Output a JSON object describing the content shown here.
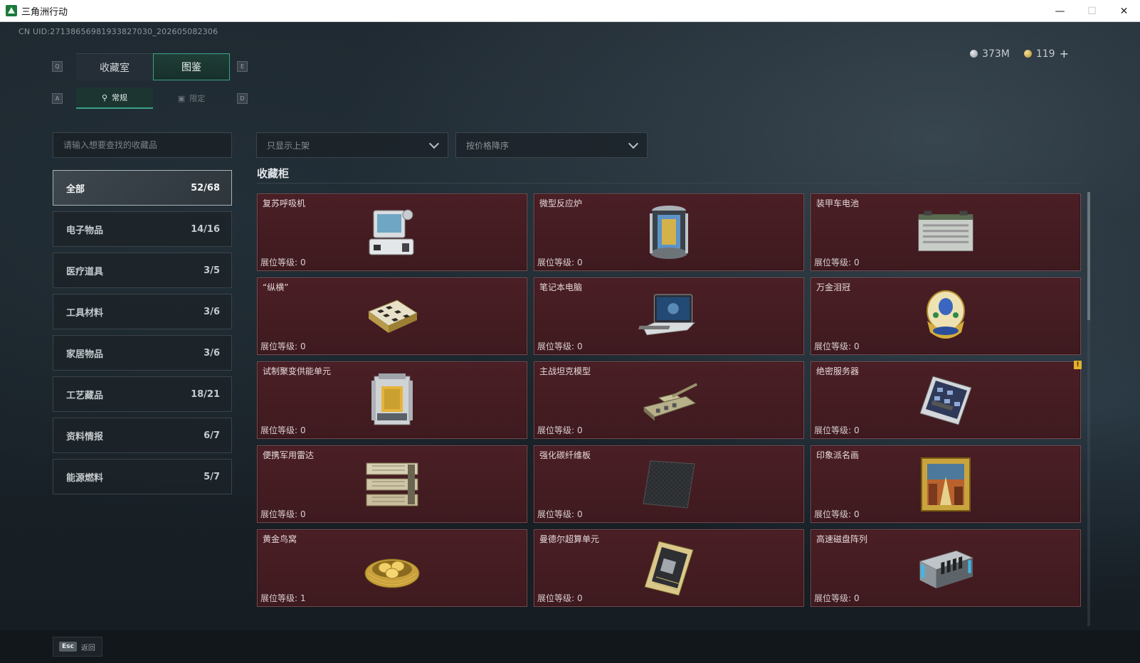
{
  "window": {
    "title": "三角洲行动",
    "min_glyph": "—",
    "max_glyph": "☐",
    "close_glyph": "✕"
  },
  "uid_text": "CN UID:27138656981933827030_202605082306",
  "currency": {
    "silver": "373M",
    "gold": "119",
    "plus": "+"
  },
  "key_hints": {
    "q": "Q",
    "e": "E",
    "a": "A",
    "d": "D"
  },
  "tabs": [
    {
      "label": "收藏室",
      "active": false
    },
    {
      "label": "图鉴",
      "active": true
    }
  ],
  "subtabs": [
    {
      "label": "常规",
      "active": true
    },
    {
      "label": "限定",
      "active": false
    }
  ],
  "search": {
    "placeholder": "请输入想要查找的收藏品"
  },
  "filters": {
    "shelf": "只显示上架",
    "sort": "按价格降序"
  },
  "categories": [
    {
      "label": "全部",
      "count": "52/68",
      "active": true
    },
    {
      "label": "电子物品",
      "count": "14/16",
      "active": false
    },
    {
      "label": "医疗道具",
      "count": "3/5",
      "active": false
    },
    {
      "label": "工具材料",
      "count": "3/6",
      "active": false
    },
    {
      "label": "家居物品",
      "count": "3/6",
      "active": false
    },
    {
      "label": "工艺藏品",
      "count": "18/21",
      "active": false
    },
    {
      "label": "资料情报",
      "count": "6/7",
      "active": false
    },
    {
      "label": "能源燃料",
      "count": "5/7",
      "active": false
    }
  ],
  "section_title": "收藏柜",
  "level_label": "展位等级:",
  "items": [
    {
      "name": "复苏呼吸机",
      "level": "0",
      "icon": "respirator-icon"
    },
    {
      "name": "微型反应炉",
      "level": "0",
      "icon": "reactor-icon"
    },
    {
      "name": "装甲车电池",
      "level": "0",
      "icon": "battery-icon"
    },
    {
      "name": "“纵横”",
      "level": "0",
      "icon": "chessboard-icon"
    },
    {
      "name": "笔记本电脑",
      "level": "0",
      "icon": "laptop-icon"
    },
    {
      "name": "万金泪冠",
      "level": "0",
      "icon": "jeweled-egg-icon"
    },
    {
      "name": "试制聚变供能单元",
      "level": "0",
      "icon": "fusion-unit-icon"
    },
    {
      "name": "主战坦克模型",
      "level": "0",
      "icon": "tank-icon"
    },
    {
      "name": "绝密服务器",
      "level": "0",
      "icon": "server-icon",
      "flag": "!"
    },
    {
      "name": "便携军用雷达",
      "level": "0",
      "icon": "radar-icon"
    },
    {
      "name": "强化碳纤维板",
      "level": "0",
      "icon": "carbon-plate-icon"
    },
    {
      "name": "印象派名画",
      "level": "0",
      "icon": "painting-icon"
    },
    {
      "name": "黄金鸟窝",
      "level": "1",
      "icon": "golden-nest-icon"
    },
    {
      "name": "曼德尔超算单元",
      "level": "0",
      "icon": "supercomputer-icon"
    },
    {
      "name": "高速磁盘阵列",
      "level": "0",
      "icon": "disk-array-icon"
    }
  ],
  "footer": {
    "esc_key": "Esc",
    "back_label": "返回"
  },
  "colors": {
    "accent": "#3aa38a",
    "card_bg": "#4a1f25",
    "card_border": "#7d4a4f",
    "flag": "#e3b02b"
  }
}
